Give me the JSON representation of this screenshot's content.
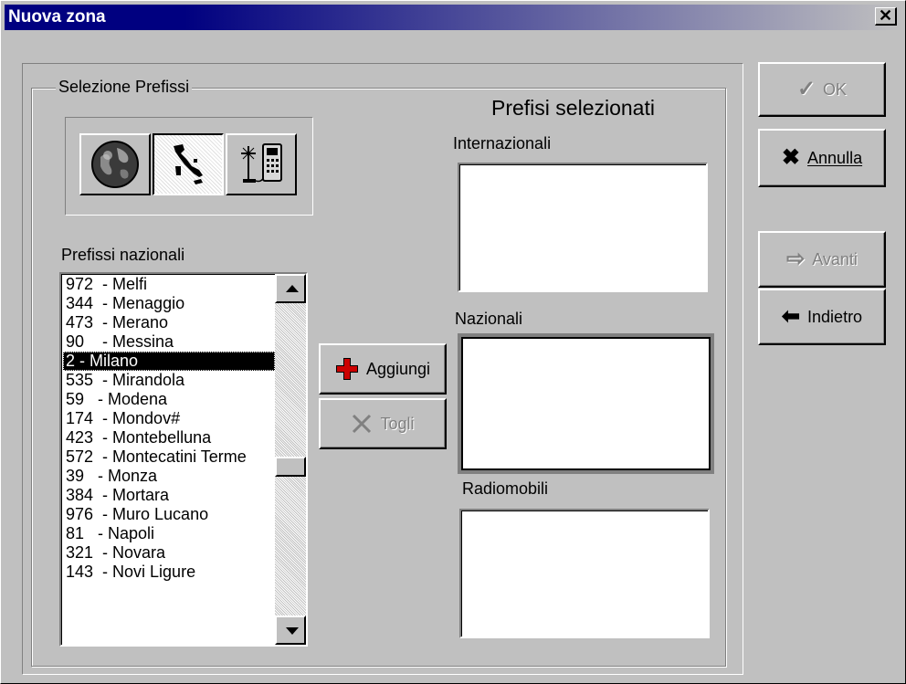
{
  "window": {
    "title": "Nuova zona",
    "close_symbol": "✕"
  },
  "group": {
    "legend": "Selezione Prefissi"
  },
  "toolbar": {
    "buttons": [
      {
        "name": "globe-icon",
        "state": "raised"
      },
      {
        "name": "italy-map-icon",
        "state": "pressed"
      },
      {
        "name": "mobile-phone-icon",
        "state": "raised"
      }
    ]
  },
  "national_list": {
    "label": "Prefissi nazionali",
    "items": [
      "972  - Melfi",
      "344  - Menaggio",
      "473  - Merano",
      "90    - Messina",
      "2 - Milano",
      "535  - Mirandola",
      "59   - Modena",
      "174  - Mondov#",
      "423  - Montebelluna",
      "572  - Montecatini Terme",
      "39   - Monza",
      "384  - Mortara",
      "976  - Muro Lucano",
      "81   - Napoli",
      "321  - Novara",
      "143  - Novi Ligure"
    ],
    "selected_index": 4
  },
  "actions": {
    "add_label": "Aggiungi",
    "remove_label": "Togli"
  },
  "selected_panel": {
    "title": "Prefisi selezionati",
    "international_label": "Internazionali",
    "national_label": "Nazionali",
    "mobile_label": "Radiomobili"
  },
  "dialog_buttons": {
    "ok": "OK",
    "cancel": "Annulla",
    "next": "Avanti",
    "back": "Indietro"
  },
  "colors": {
    "title_bar": "#000080",
    "face": "#c0c0c0",
    "add_icon": "#cc0000",
    "selection": "#000000"
  }
}
